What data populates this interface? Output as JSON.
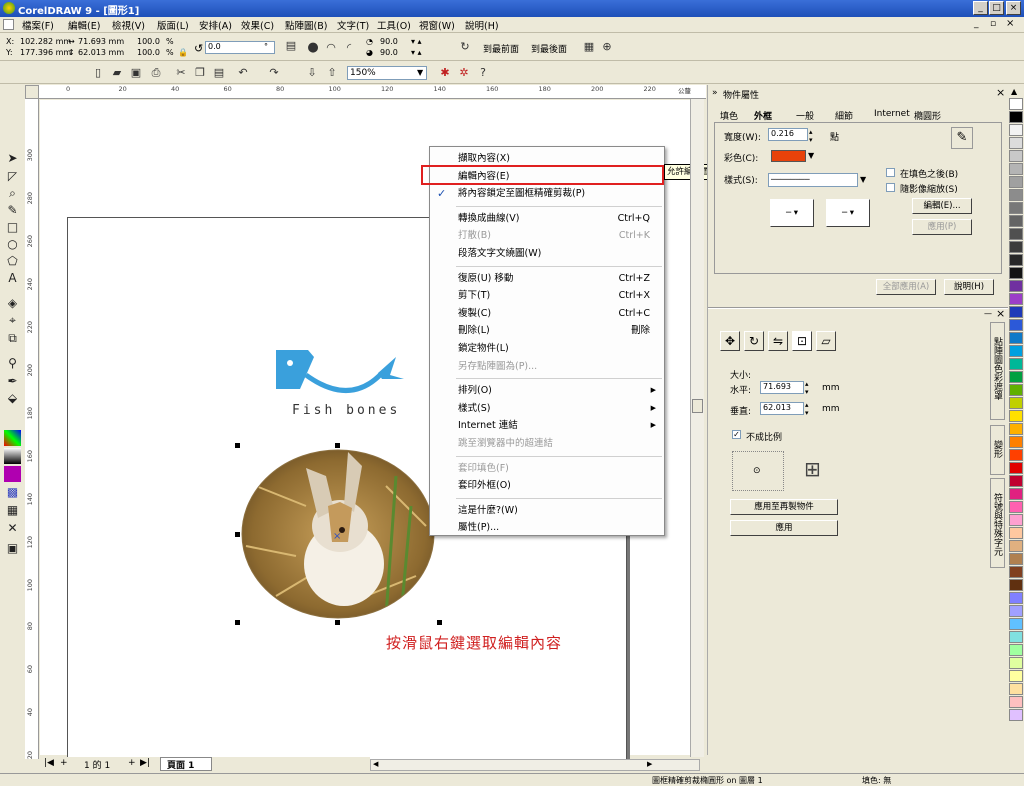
{
  "title_bar": {
    "title": "CorelDRAW 9 - [圖形1]",
    "min": "_",
    "max": "□",
    "close": "×"
  },
  "menubar": [
    "檔案(F)",
    "編輯(E)",
    "檢視(V)",
    "版面(L)",
    "安排(A)",
    "效果(C)",
    "點陣圖(B)",
    "文字(T)",
    "工具(O)",
    "視窗(W)",
    "說明(H)"
  ],
  "propertybar": {
    "x_label": "X:",
    "x": "102.282 mm",
    "y_label": "Y:",
    "y": "177.396 mm",
    "w": "71.693 mm",
    "h": "62.013 mm",
    "sx": "100.0",
    "sy": "100.0",
    "sx_unit": "%",
    "sy_unit": "%",
    "rotate": "0.0",
    "deg": "°",
    "corner1": "90.0",
    "corner2": "90.0",
    "to_front": "到最前面",
    "to_back": "到最後面"
  },
  "standardbar": {
    "zoom": "150%"
  },
  "rulers": {
    "h": [
      "0",
      "20",
      "40",
      "60",
      "80",
      "100",
      "120",
      "140",
      "160",
      "180",
      "200",
      "220"
    ],
    "v": [
      "300",
      "280",
      "260",
      "240",
      "220",
      "200",
      "180",
      "160",
      "140",
      "120",
      "100",
      "80",
      "60",
      "40",
      "20"
    ],
    "unit": "公釐"
  },
  "canvas": {
    "logo_text": "Fish bones",
    "caption": "按滑鼠右鍵選取編輯內容"
  },
  "context_menu": {
    "items": [
      {
        "label": "擷取內容(X)",
        "shortcut": "",
        "disabled": false
      },
      {
        "label": "編輯內容(E)",
        "shortcut": "",
        "disabled": false
      },
      {
        "label": "將內容鎖定至圖框精確剪裁(P)",
        "shortcut": "",
        "disabled": false,
        "checked": true
      },
      {
        "sep": true
      },
      {
        "label": "轉換成曲線(V)",
        "shortcut": "Ctrl+Q",
        "disabled": false
      },
      {
        "label": "打散(B)",
        "shortcut": "Ctrl+K",
        "disabled": true
      },
      {
        "label": "段落文字文繞圖(W)",
        "shortcut": "",
        "disabled": false
      },
      {
        "sep": true
      },
      {
        "label": "復原(U) 移動",
        "shortcut": "Ctrl+Z",
        "disabled": false
      },
      {
        "label": "剪下(T)",
        "shortcut": "Ctrl+X",
        "disabled": false
      },
      {
        "label": "複製(C)",
        "shortcut": "Ctrl+C",
        "disabled": false
      },
      {
        "label": "刪除(L)",
        "shortcut": "刪除",
        "disabled": false
      },
      {
        "label": "鎖定物件(L)",
        "shortcut": "",
        "disabled": false
      },
      {
        "label": "另存點陣圖為(P)...",
        "shortcut": "",
        "disabled": true
      },
      {
        "sep": true
      },
      {
        "label": "排列(O)",
        "shortcut": "",
        "disabled": false,
        "submenu": true
      },
      {
        "label": "樣式(S)",
        "shortcut": "",
        "disabled": false,
        "submenu": true
      },
      {
        "label": "Internet 連結",
        "shortcut": "",
        "disabled": false,
        "submenu": true
      },
      {
        "label": "跳至瀏覽器中的超連結",
        "shortcut": "",
        "disabled": true
      },
      {
        "sep": true
      },
      {
        "label": "套印填色(F)",
        "shortcut": "",
        "disabled": true
      },
      {
        "label": "套印外框(O)",
        "shortcut": "",
        "disabled": false
      },
      {
        "sep": true
      },
      {
        "label": "這是什麼?(W)",
        "shortcut": "",
        "disabled": false
      },
      {
        "label": "屬性(P)...",
        "shortcut": "",
        "disabled": false
      }
    ],
    "tooltip": "允許編輯圖框精確剪裁容器內的物件"
  },
  "docker": {
    "title": "物件屬性",
    "tabs": [
      "填色",
      "外框",
      "一般",
      "細節",
      "Internet",
      "橢圓形"
    ],
    "width_label": "寬度(W):",
    "width": "0.216",
    "width_unit": "點",
    "color_label": "彩色(C):",
    "color": "#e8420a",
    "style_label": "樣式(S):",
    "behind_fill": "在填色之後(B)",
    "scale_image": "隨影像縮放(S)",
    "edit_btn": "編輯(E)...",
    "apply_btn_top": "應用(P)",
    "apply_all": "全部應用(A)",
    "help": "說明(H)",
    "size_label": "大小:",
    "h_label": "水平:",
    "h_val": "71.693",
    "h_unit": "mm",
    "v_label": "垂直:",
    "v_val": "62.013",
    "v_unit": "mm",
    "nonprop": "不成比例",
    "apply_dup": "應用至再製物件",
    "apply": "應用"
  },
  "side_tabs": [
    "點陣圖色彩遮罩",
    "變形",
    "符號與特殊字元"
  ],
  "page_nav": {
    "count": "1 的 1",
    "page": "頁面 1"
  },
  "status": {
    "object": "圖框精確剪裁橢圓形 on 圖層 1",
    "fill": "填色: 無"
  },
  "palette": [
    "#ffffff",
    "#000000",
    "#f2f2f2",
    "#dcdcdc",
    "#c8c8c8",
    "#b4b4b4",
    "#a0a0a0",
    "#8c8c8c",
    "#787878",
    "#646464",
    "#505050",
    "#3c3c3c",
    "#282828",
    "#141414",
    "#7030a0",
    "#9b3ec8",
    "#1f3ab8",
    "#2c59d8",
    "#0f7ac8",
    "#00a0e0",
    "#00b898",
    "#00a040",
    "#60b000",
    "#c0d000",
    "#ffe000",
    "#ffb000",
    "#ff8000",
    "#ff4000",
    "#e00000",
    "#c00030",
    "#e02080",
    "#ff60b0",
    "#ffa0d0",
    "#ffc8a0",
    "#e0b080",
    "#b08050",
    "#804020",
    "#603010",
    "#8080ff",
    "#a0a0ff",
    "#60c0ff",
    "#80e0e0",
    "#a0ffa0",
    "#e0ffa0",
    "#ffffa0",
    "#ffe0a0",
    "#ffc0c0",
    "#e0c0ff"
  ]
}
